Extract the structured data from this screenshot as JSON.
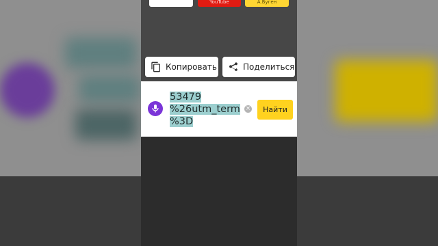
{
  "top_buttons": {
    "youtube": "YouTube",
    "yandex": "А.Буген"
  },
  "actions": {
    "copy": "Копировать",
    "share": "Поделиться"
  },
  "search": {
    "query_lines": [
      "53479",
      "%26utm_term",
      "%3D"
    ],
    "clear": "×",
    "submit": "Найти"
  },
  "colors": {
    "accent_yellow": "#ffd21f",
    "mic_purple": "#7b35d8",
    "selection": "#9ccfcf",
    "youtube_red": "#e11b12"
  },
  "icons": {
    "copy": "copy-icon",
    "share": "share-icon",
    "mic": "microphone-icon",
    "clear": "clear-icon"
  }
}
